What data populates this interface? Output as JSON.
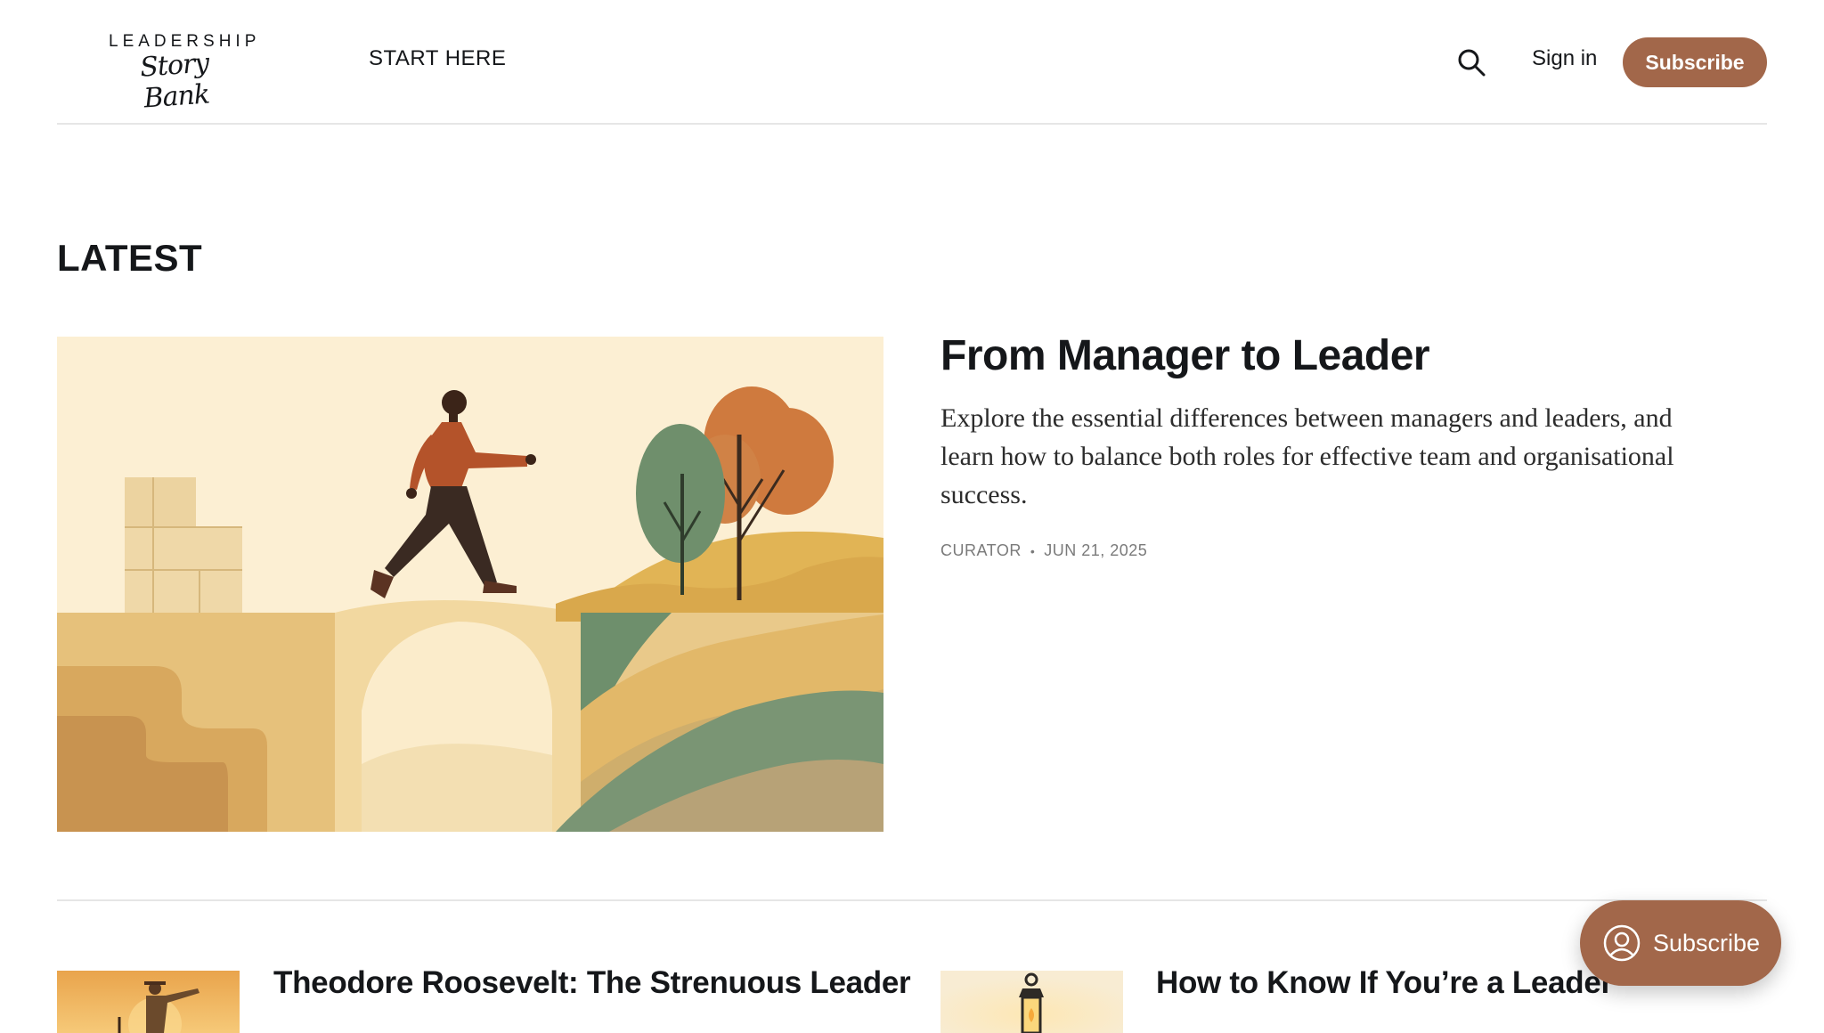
{
  "header": {
    "logo_top": "LEADERSHIP",
    "logo_script": "Story Bank",
    "nav_start": "START HERE",
    "search_icon": "search-icon",
    "signin_label": "Sign in",
    "subscribe_label": "Subscribe"
  },
  "latest": {
    "section_title": "LATEST",
    "feature": {
      "title": "From Manager to Leader",
      "excerpt": "Explore the essential differences between managers and leaders, and learn how to balance both roles for effective team and organisational success.",
      "author": "CURATOR",
      "separator": "•",
      "date": "JUN 21, 2025"
    },
    "cards": [
      {
        "title": "Theodore Roosevelt: The Strenuous Leader"
      },
      {
        "title": "How to Know If You’re a Leader"
      }
    ]
  },
  "portal": {
    "label": "Subscribe",
    "icon": "user-circle-icon"
  },
  "colors": {
    "accent": "#a2674a",
    "text": "#15171a",
    "divider": "#e6e6e6"
  }
}
